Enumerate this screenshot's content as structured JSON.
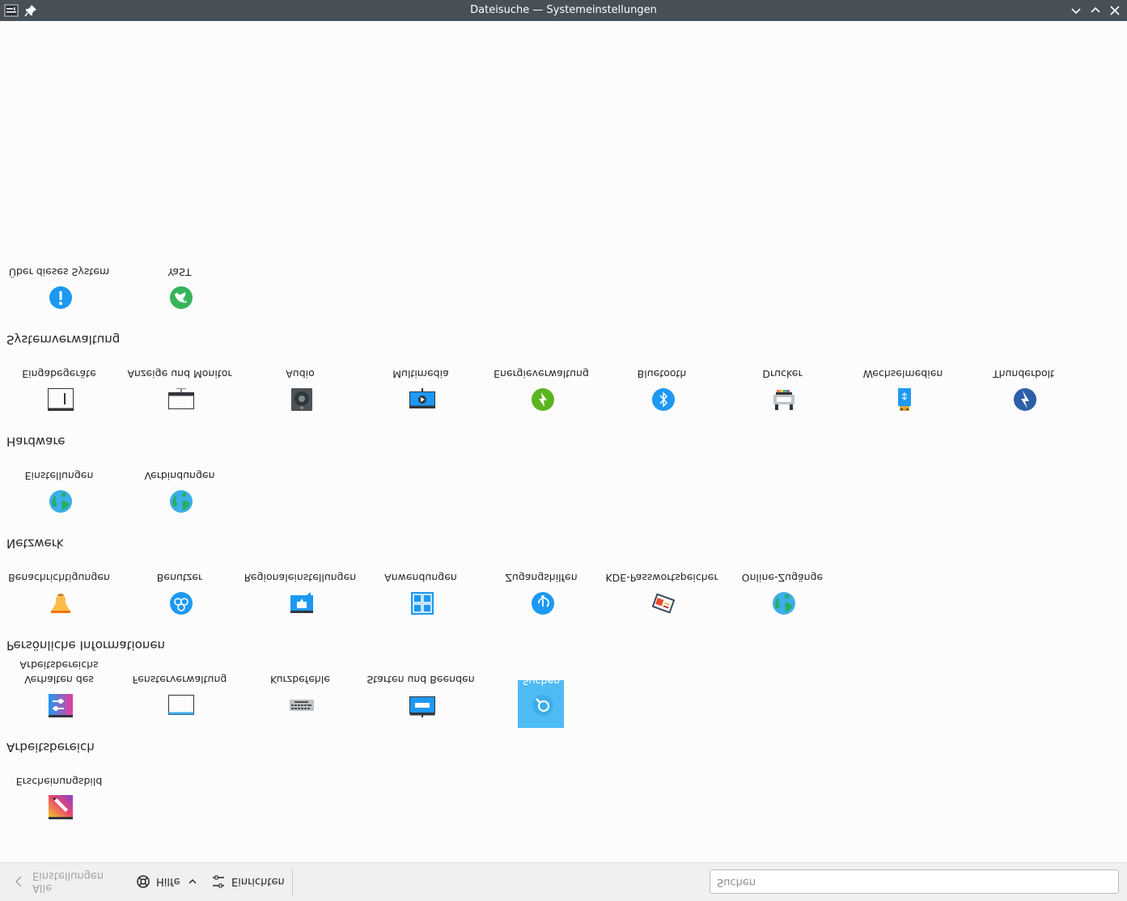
{
  "window": {
    "title": "Dateisuche — Systemeinstellungen"
  },
  "categories": [
    {
      "title": "Erscheinungsbild",
      "title_hidden": true,
      "items": [
        {
          "label": "Erscheinungsbild",
          "icon": "appearance-icon"
        }
      ]
    },
    {
      "title": "Arbeitsbereich",
      "items": [
        {
          "label": "Verhalten des Arbeitsbereichs",
          "icon": "workspace-behavior-icon"
        },
        {
          "label": "Fensterverwaltung",
          "icon": "window-management-icon"
        },
        {
          "label": "Kurzbefehle",
          "icon": "keyboard-icon"
        },
        {
          "label": "Starten und Beenden",
          "icon": "startup-shutdown-icon"
        },
        {
          "label": "Suchen",
          "icon": "search-icon",
          "selected": true
        }
      ]
    },
    {
      "title": "Persönliche Informationen",
      "items": [
        {
          "label": "Benachrichtigungen",
          "icon": "notification-bell-icon"
        },
        {
          "label": "Benutzer",
          "icon": "users-icon"
        },
        {
          "label": "Regionaleinstellungen",
          "icon": "regional-settings-icon"
        },
        {
          "label": "Anwendungen",
          "icon": "applications-icon"
        },
        {
          "label": "Zugangshilfen",
          "icon": "accessibility-icon"
        },
        {
          "label": "KDE-Passwortspeicher",
          "icon": "wallet-icon"
        },
        {
          "label": "Online-Zugänge",
          "icon": "online-accounts-globe-icon"
        }
      ]
    },
    {
      "title": "Netzwerk",
      "items": [
        {
          "label": "Einstellungen",
          "icon": "network-settings-globe-icon"
        },
        {
          "label": "Verbindungen",
          "icon": "connections-globe-icon"
        }
      ]
    },
    {
      "title": "Hardware",
      "items": [
        {
          "label": "Eingabegeräte",
          "icon": "input-devices-icon"
        },
        {
          "label": "Anzeige und Monitor",
          "icon": "display-monitor-icon"
        },
        {
          "label": "Audio",
          "icon": "speaker-icon"
        },
        {
          "label": "Multimedia",
          "icon": "multimedia-icon"
        },
        {
          "label": "Energieverwaltung",
          "icon": "power-management-icon"
        },
        {
          "label": "Bluetooth",
          "icon": "bluetooth-icon"
        },
        {
          "label": "Drucker",
          "icon": "printer-icon"
        },
        {
          "label": "Wechselmedien",
          "icon": "removable-media-icon"
        },
        {
          "label": "Thunderbolt",
          "icon": "thunderbolt-icon"
        }
      ]
    },
    {
      "title": "Systemverwaltung",
      "items": [
        {
          "label": "Über dieses System",
          "icon": "info-icon"
        },
        {
          "label": "YaST",
          "icon": "yast-icon"
        }
      ]
    }
  ],
  "bottombar": {
    "back_label": "Alle Einstellungen",
    "help_label": "Hilfe",
    "configure_label": "Einrichten",
    "search_placeholder": "Suchen"
  },
  "colors": {
    "titlebar": "#475057",
    "selection": "#4fbbf5",
    "background": "#fcfcfc"
  }
}
